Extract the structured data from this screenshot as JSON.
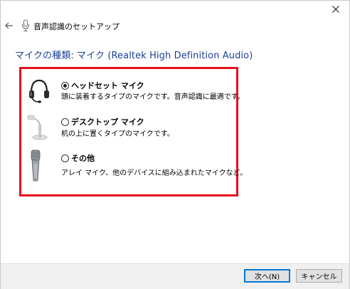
{
  "window": {
    "title": "音声認識のセットアップ",
    "close_icon": "close-icon",
    "back_icon": "back-arrow-icon",
    "title_icon": "microphone-icon"
  },
  "heading": "マイクの種類: マイク (Realtek High Definition Audio)",
  "options": [
    {
      "label": "ヘッドセット マイク",
      "description": "頭に装着するタイプのマイクです。音声認識に最適です。",
      "selected": true,
      "icon": "headset-icon"
    },
    {
      "label": "デスクトップ マイク",
      "description": "机の上に置くタイプのマイクです。",
      "selected": false,
      "icon": "desktop-microphone-icon"
    },
    {
      "label": "その他",
      "description": "アレイ マイク、他のデバイスに組み込まれたマイクなど。",
      "selected": false,
      "icon": "handheld-microphone-icon"
    }
  ],
  "buttons": {
    "next": "次へ(N)",
    "cancel": "キャンセル"
  },
  "colors": {
    "heading": "#1a3f96",
    "highlight_border": "#e8101e",
    "footer_bg": "#f0f0f0"
  }
}
